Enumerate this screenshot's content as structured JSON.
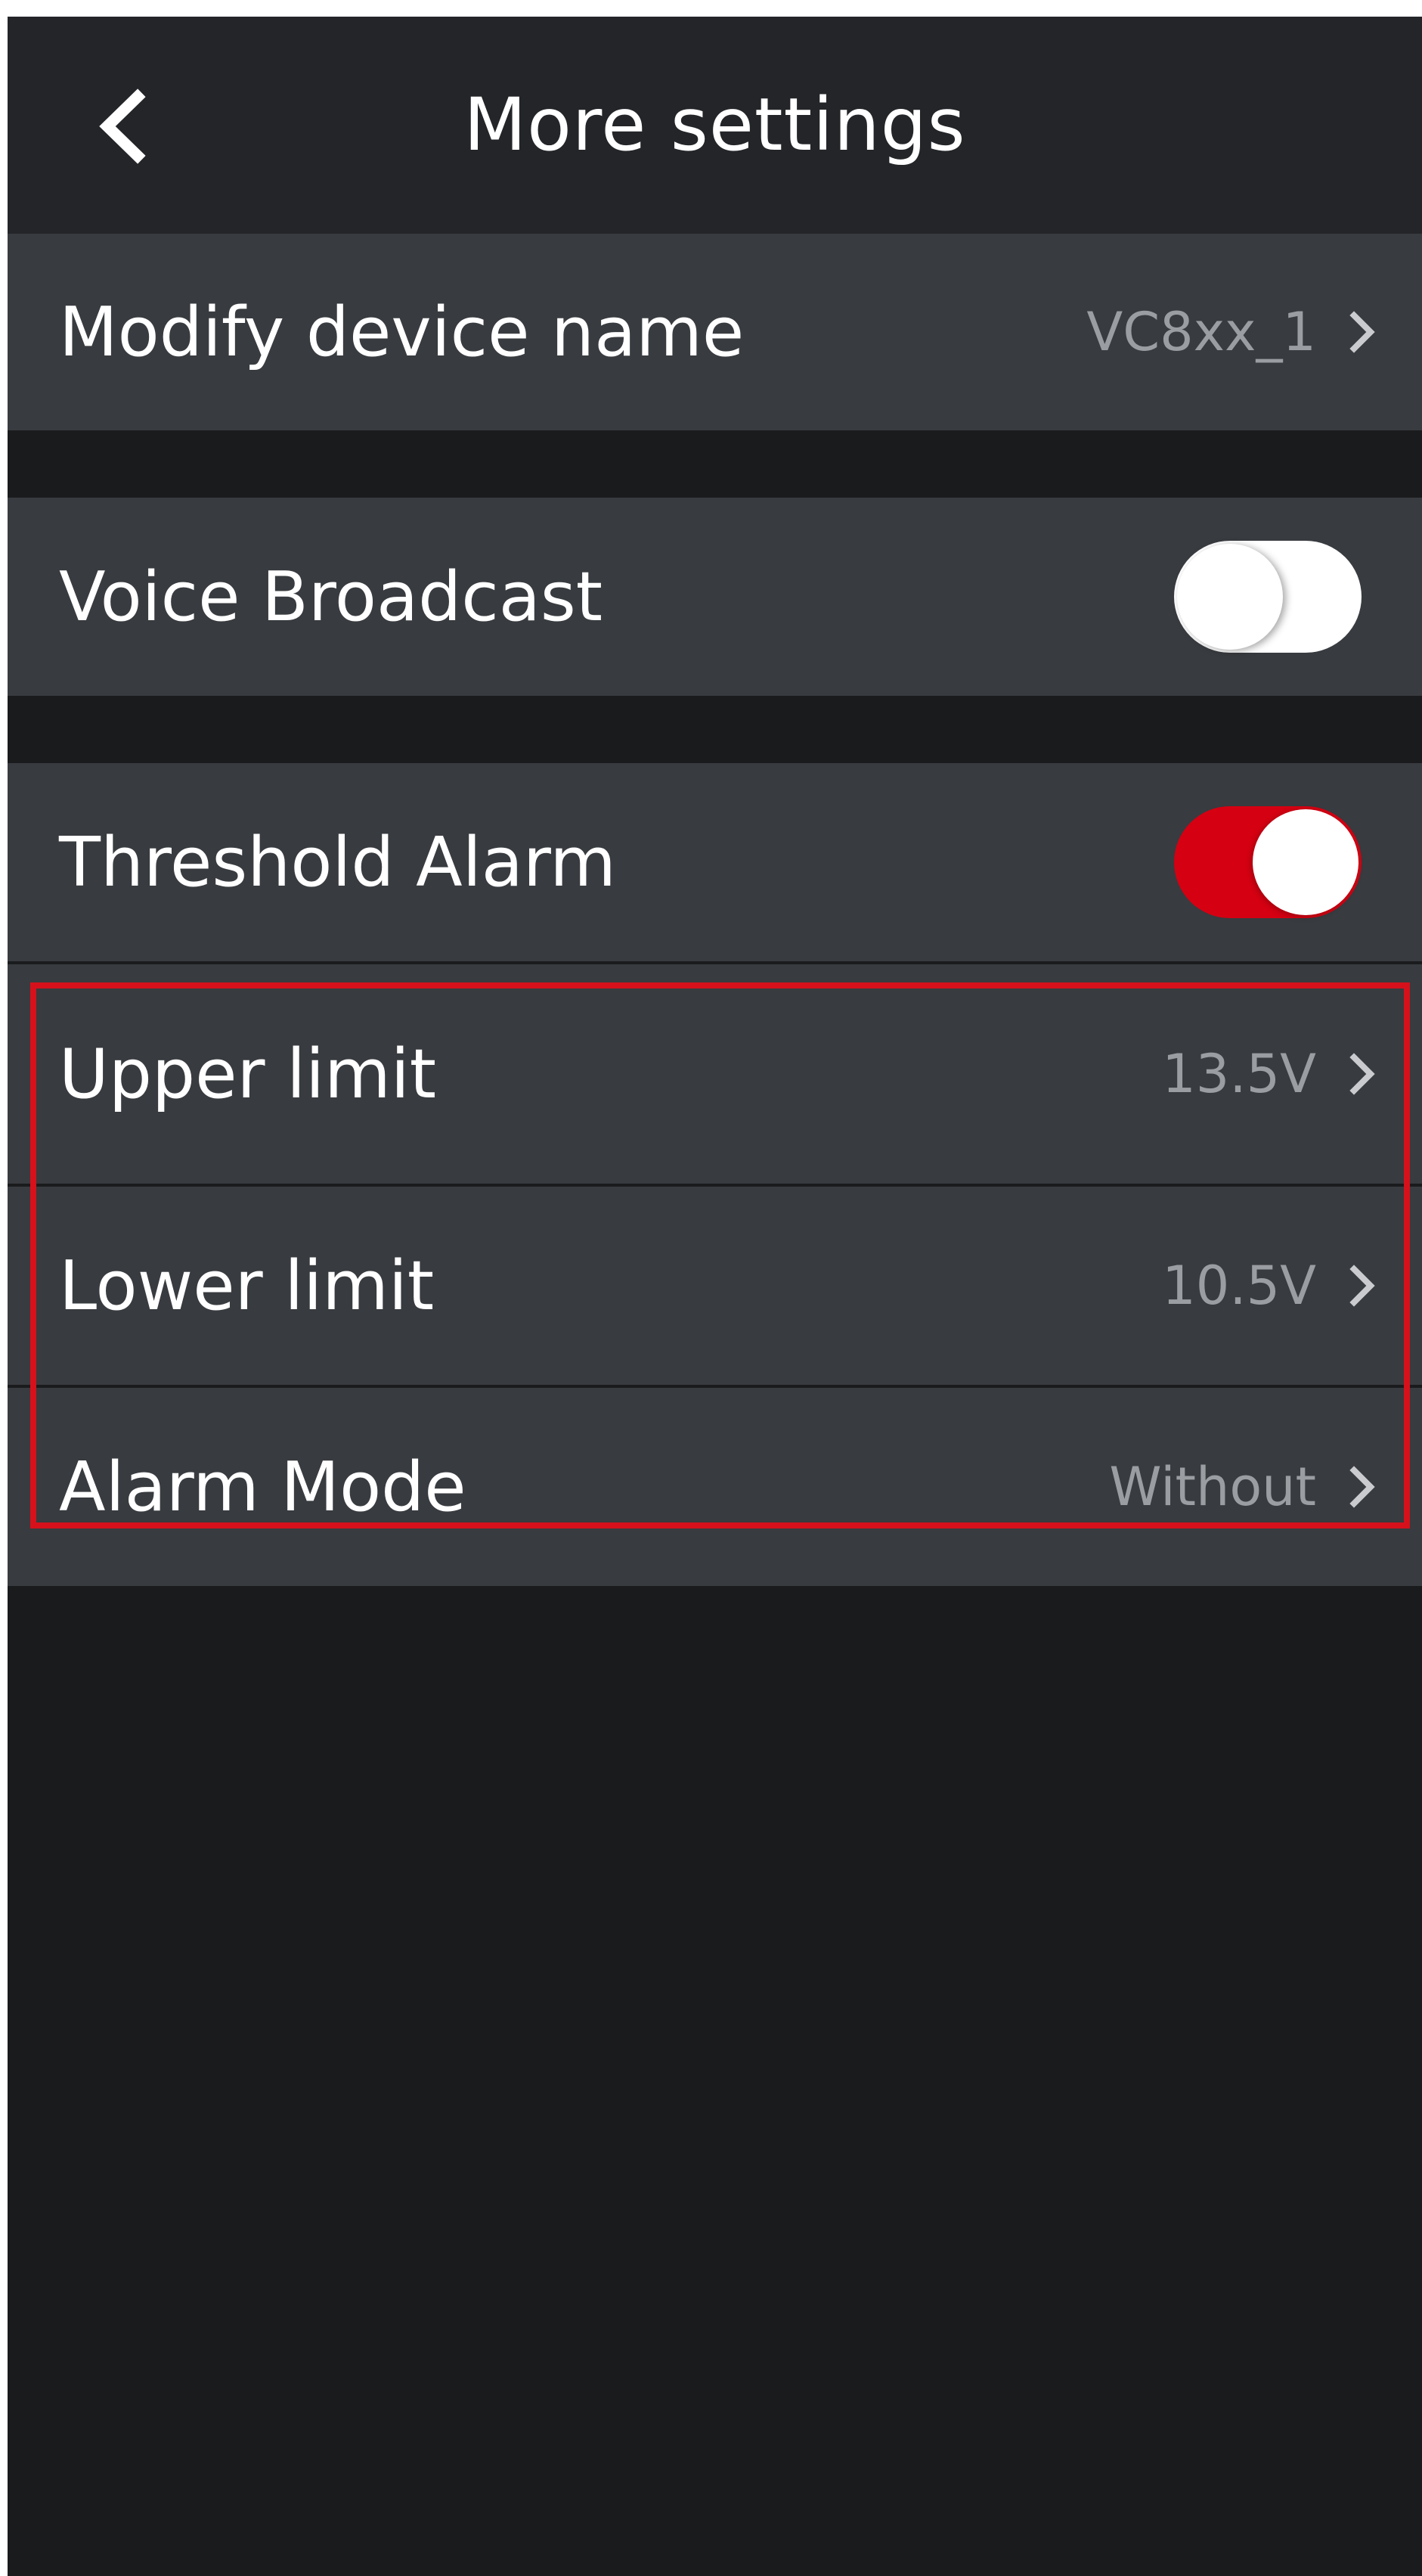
{
  "header": {
    "title": "More settings",
    "back_icon": "chevron-left-icon"
  },
  "rows": {
    "device_name": {
      "label": "Modify device name",
      "value": "VC8xx_1"
    },
    "voice_broadcast": {
      "label": "Voice Broadcast",
      "enabled": false
    },
    "threshold_alarm": {
      "label": "Threshold Alarm",
      "enabled": true
    },
    "upper_limit": {
      "label": "Upper limit",
      "value": "13.5V"
    },
    "lower_limit": {
      "label": "Lower limit",
      "value": "10.5V"
    },
    "alarm_mode": {
      "label": "Alarm Mode",
      "value": "Without"
    }
  },
  "colors": {
    "background": "#1a1b1d",
    "header": "#232528",
    "row": "#383b3f",
    "accent_red": "#d50012",
    "highlight_border": "#d6111b",
    "value_text": "#9a9da1"
  }
}
